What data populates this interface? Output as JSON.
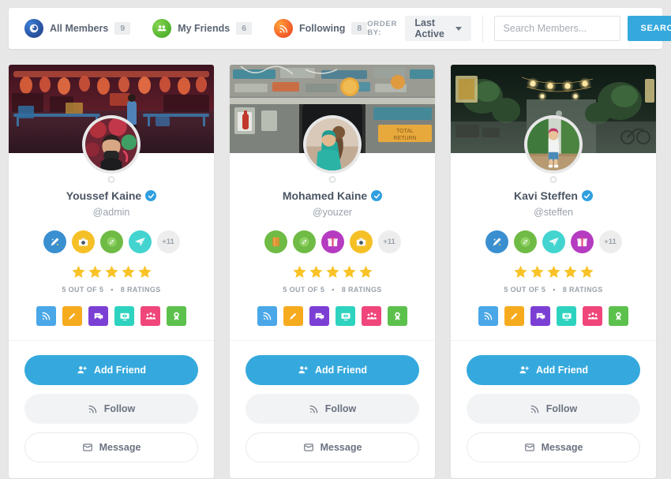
{
  "header": {
    "tabs": [
      {
        "label": "All Members",
        "count": "9",
        "icon": "members-icon"
      },
      {
        "label": "My Friends",
        "count": "6",
        "icon": "friends-icon"
      },
      {
        "label": "Following",
        "count": "8",
        "icon": "rss-icon"
      }
    ],
    "order_by_label": "ORDER BY:",
    "order_by_value": "Last Active",
    "search_placeholder": "Search Members...",
    "search_value": "",
    "search_button": "SEARCH"
  },
  "colors": {
    "accent": "#35a9dd",
    "page_bg": "#e7e7e7",
    "card_bg": "#ffffff",
    "star": "#f9c327",
    "muted_text": "#9aa2ab",
    "name_text": "#4b5563"
  },
  "social_icons": [
    {
      "name": "rss-icon",
      "color": "#4aa7e8"
    },
    {
      "name": "pencil-icon",
      "color": "#f6ab1e"
    },
    {
      "name": "chat-icon",
      "color": "#7c3fd4"
    },
    {
      "name": "monitor-icon",
      "color": "#2ed3c0"
    },
    {
      "name": "group-icon",
      "color": "#f0467b"
    },
    {
      "name": "award-icon",
      "color": "#5cc14c"
    }
  ],
  "buttons": {
    "add_friend": "Add Friend",
    "follow": "Follow",
    "message": "Message"
  },
  "rating_common": {
    "score_text": "5 OUT OF 5",
    "separator": "•",
    "count_text": "8 RATINGS",
    "stars": 5
  },
  "members": [
    {
      "name": "Youssef Kaine",
      "handle": "@admin",
      "verified": true,
      "cover": "night-market-street",
      "avatar": "man-with-mask-neon",
      "badges": [
        {
          "name": "pen-badge",
          "color": "#3a8fd0"
        },
        {
          "name": "camera-badge",
          "color": "#f5c026"
        },
        {
          "name": "compass-badge",
          "color": "#6fbb45"
        },
        {
          "name": "paperplane-badge",
          "color": "#43d4d0"
        }
      ],
      "badge_more": "+11",
      "rating": {
        "score_text": "5 OUT OF 5",
        "count_text": "8 RATINGS",
        "stars": 5
      }
    },
    {
      "name": "Mohamed Kaine",
      "handle": "@youzer",
      "verified": true,
      "cover": "graffiti-sign-wall",
      "avatar": "kids-in-teal",
      "badges": [
        {
          "name": "book-badge",
          "color": "#6fbb45"
        },
        {
          "name": "compass-badge",
          "color": "#6fbb45"
        },
        {
          "name": "gift-badge",
          "color": "#b53bc0"
        },
        {
          "name": "camera-badge",
          "color": "#f5c026"
        }
      ],
      "badge_more": "+11",
      "rating": {
        "score_text": "5 OUT OF 5",
        "count_text": "8 RATINGS",
        "stars": 5
      }
    },
    {
      "name": "Kavi Steffen",
      "handle": "@steffen",
      "verified": true,
      "cover": "lantern-alley-night",
      "avatar": "kid-on-bench",
      "badges": [
        {
          "name": "pen-badge",
          "color": "#3a8fd0"
        },
        {
          "name": "compass-badge",
          "color": "#6fbb45"
        },
        {
          "name": "paperplane-badge",
          "color": "#43d4d0"
        },
        {
          "name": "gift-badge",
          "color": "#b53bc0"
        }
      ],
      "badge_more": "+11",
      "rating": {
        "score_text": "5 OUT OF 5",
        "count_text": "8 RATINGS",
        "stars": 5
      }
    }
  ]
}
